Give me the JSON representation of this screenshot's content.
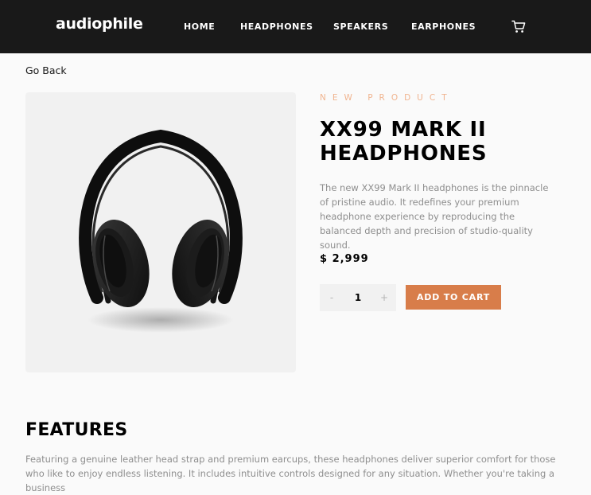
{
  "header": {
    "logo": "audiophile",
    "nav": [
      {
        "label": "HOME"
      },
      {
        "label": "HEADPHONES"
      },
      {
        "label": "SPEAKERS"
      },
      {
        "label": "EARPHONES"
      }
    ],
    "cart_icon": "cart-icon"
  },
  "go_back": "Go Back",
  "product": {
    "overline": "NEW PRODUCT",
    "title": "XX99 MARK II HEADPHONES",
    "description": "The new XX99 Mark II headphones is the pinnacle of pristine audio. It redefines your premium headphone experience by reproducing the balanced depth and precision of studio-quality sound.",
    "price": "$ 2,999",
    "quantity": {
      "minus": "-",
      "value": "1",
      "plus": "+"
    },
    "add_to_cart": "ADD TO CART",
    "image_icon": "headphones-image"
  },
  "features": {
    "heading": "FEATURES",
    "text": "Featuring a genuine leather head strap and premium earcups, these headphones deliver superior comfort for those who like to enjoy endless listening. It includes intuitive controls designed for any situation. Whether you're taking a business"
  },
  "colors": {
    "header_bg": "#191919",
    "accent": "#d87d4a",
    "accent_light": "#f0b48f",
    "page_bg": "#fafafa",
    "panel_bg": "#f1f1f1"
  }
}
